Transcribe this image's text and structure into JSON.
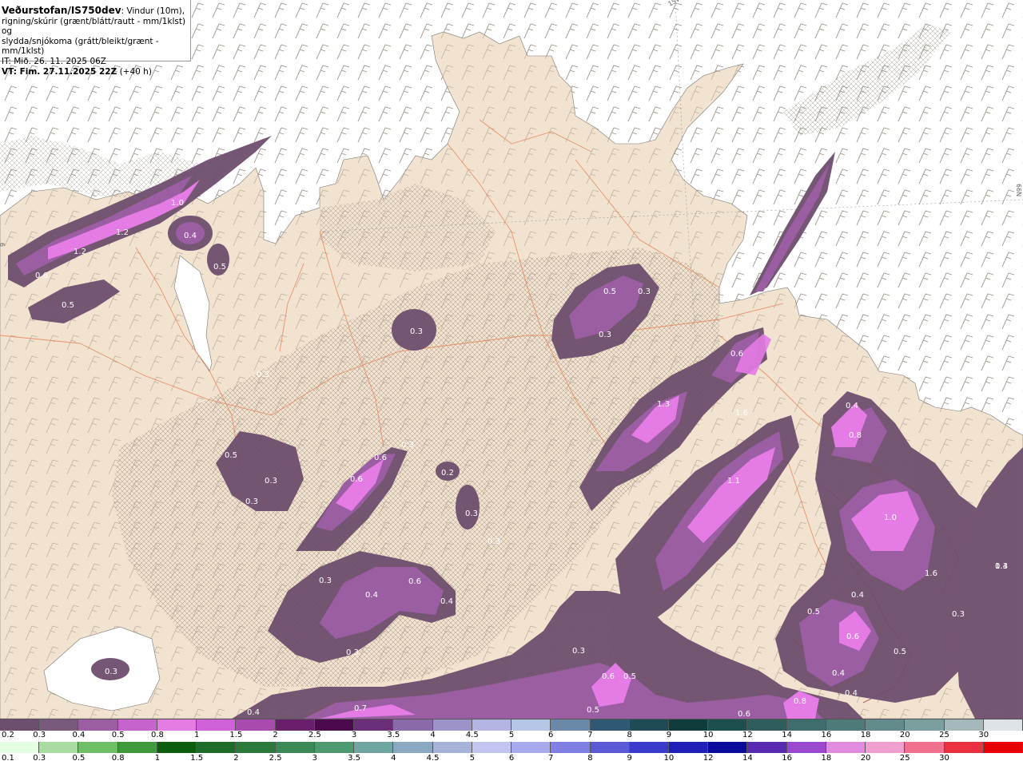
{
  "header": {
    "title": "Veðurstofan/IS750dev",
    "desc_line1": ": Vindur (10m),",
    "desc_line2": "rigning/skúrir (grænt/blátt/rautt - mm/1klst) og",
    "desc_line3": "slydda/snjókoma (grátt/bleikt/grænt - mm/1klst)",
    "it_line": "IT: Mið. 26. 11. 2025 06Z",
    "vt_line": "VT: Fim. 27.11.2025 22Z",
    "vt_offset": " (+40 h)"
  },
  "edge_labels": {
    "top": "15W",
    "right": "66N",
    "left": "9"
  },
  "map_values": [
    "1.0",
    "1.2",
    "1.2",
    "0.4",
    "0.6",
    "0.5",
    "0.5",
    "0.3",
    "0.3",
    "0.5",
    "0.3",
    "0.3",
    "0.6",
    "0.6",
    "0.3",
    "0.2",
    "0.3",
    "0.3",
    "0.5",
    "0.3",
    "0.3",
    "0.6",
    "1.3",
    "1.6",
    "0.4",
    "0.8",
    "1.1",
    "1.0",
    "1.6",
    "1.3",
    "0.4",
    "0.3",
    "0.3",
    "0.4",
    "0.6",
    "0.4",
    "0.3",
    "0.3",
    "0.5",
    "0.4",
    "0.6",
    "0.4",
    "0.4",
    "0.5",
    "0.6",
    "0.5",
    "0.3",
    "0.4",
    "0.7",
    "0.5",
    "0.6",
    "0.8"
  ],
  "legend": {
    "snow_scale": {
      "labels": [
        "0.2",
        "0.3",
        "0.4",
        "0.5",
        "0.8",
        "1",
        "1.5",
        "2",
        "2.5",
        "3",
        "3.5",
        "4",
        "4.5",
        "5",
        "6",
        "7",
        "8",
        "9",
        "10",
        "12",
        "14",
        "16",
        "18",
        "20",
        "25",
        "30"
      ],
      "colors": [
        "#6e4e6e",
        "#7a5a7c",
        "#9c5ea3",
        "#c763cd",
        "#e57be5",
        "#d061d8",
        "#a84aae",
        "#6a1f6c",
        "#4a0a4d",
        "#6a2f78",
        "#8a6aa8",
        "#9e93c8",
        "#b4b5e3",
        "#b6c6e6",
        "#6a88a8",
        "#2f5873",
        "#1f4b57",
        "#113c3c",
        "#1e4f4f",
        "#2f5d5d",
        "#3f6c6c",
        "#4f7a7a",
        "#638b8b",
        "#7b9e9e",
        "#a5b8bc",
        "#dde3e6"
      ]
    },
    "rain_scale": {
      "labels": [
        "0.1",
        "0.3",
        "0.5",
        "0.8",
        "1",
        "1.5",
        "2",
        "2.5",
        "3",
        "3.5",
        "4",
        "4.5",
        "5",
        "6",
        "7",
        "8",
        "9",
        "10",
        "12",
        "14",
        "16",
        "18",
        "20",
        "25",
        "30"
      ],
      "colors": [
        "#e5ffe5",
        "#a8dca0",
        "#6fbf66",
        "#3e9a3a",
        "#0c5e0c",
        "#1f6b2a",
        "#2c7a3c",
        "#3b8a55",
        "#4d9a70",
        "#6fa6a0",
        "#8aa8c0",
        "#a6b2d8",
        "#c4c4f0",
        "#a9a9ee",
        "#7f7fe4",
        "#5a5ad4",
        "#3a3acc",
        "#2020b8",
        "#0a0a9c",
        "#5a2ab0",
        "#9a48d0",
        "#e08ae0",
        "#f0a0d0",
        "#f07090",
        "#e83040",
        "#e80000"
      ]
    }
  },
  "colors": {
    "sea": "#ffffff",
    "land": "#f2e2d0",
    "land_hatched": "#e4d3c0",
    "precip_outer": "#6e4e6e",
    "precip_mid": "#9c5ea3",
    "precip_inner": "#e57be5",
    "roads": "#e8825a",
    "borders": "#8a1a1a"
  }
}
